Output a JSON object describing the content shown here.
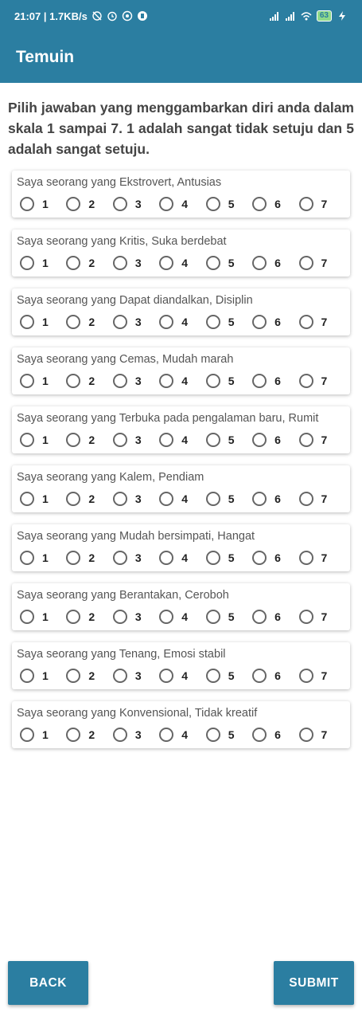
{
  "status_bar": {
    "time_speed": "21:07 | 1.7KB/s",
    "battery": "63",
    "icons": [
      "alarm-off-icon",
      "alarm-icon",
      "whatsapp-icon",
      "app-icon",
      "signal-icon",
      "signal-icon",
      "wifi-icon",
      "battery-icon",
      "charging-icon"
    ]
  },
  "app_bar": {
    "title": "Temuin"
  },
  "instruction": "Pilih jawaban yang menggambarkan diri anda dalam skala 1 sampai 7. 1 adalah sangat tidak setuju dan 5 adalah sangat setuju.",
  "scale_options": [
    "1",
    "2",
    "3",
    "4",
    "5",
    "6",
    "7"
  ],
  "questions": [
    "Saya seorang yang Ekstrovert, Antusias",
    "Saya seorang yang Kritis, Suka berdebat",
    "Saya seorang yang Dapat diandalkan, Disiplin",
    "Saya seorang yang Cemas, Mudah marah",
    "Saya seorang yang Terbuka pada pengalaman baru, Rumit",
    "Saya seorang yang Kalem, Pendiam",
    "Saya seorang yang Mudah bersimpati, Hangat",
    "Saya seorang yang Berantakan, Ceroboh",
    "Saya seorang yang Tenang, Emosi stabil",
    "Saya seorang yang Konvensional, Tidak kreatif"
  ],
  "buttons": {
    "back": "BACK",
    "submit": "SUBMIT"
  },
  "colors": {
    "primary": "#2b7ea1",
    "radio_border": "#666666"
  }
}
